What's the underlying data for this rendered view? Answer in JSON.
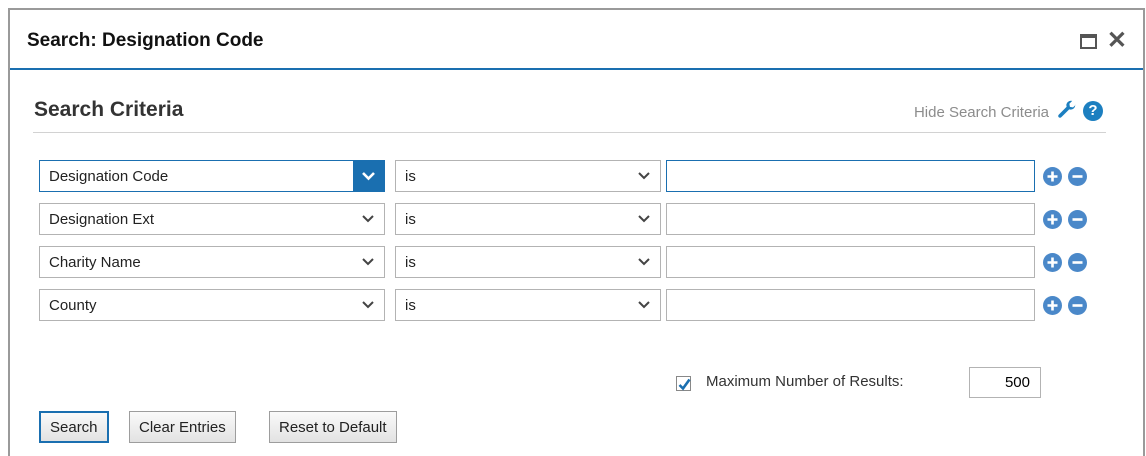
{
  "window": {
    "title": "Search: Designation Code",
    "maximize_icon": "maximize-icon",
    "close_icon": "close-icon",
    "close_glyph": "✕"
  },
  "section": {
    "title": "Search Criteria",
    "hide_link": "Hide Search Criteria",
    "wrench_icon": "wrench-icon",
    "help_icon": "help-icon",
    "help_glyph": "?"
  },
  "criteria": [
    {
      "field": "Designation Code",
      "operator": "is",
      "value": ""
    },
    {
      "field": "Designation Ext",
      "operator": "is",
      "value": ""
    },
    {
      "field": "Charity Name",
      "operator": "is",
      "value": ""
    },
    {
      "field": "County",
      "operator": "is",
      "value": ""
    }
  ],
  "max_results": {
    "checked": true,
    "label": "Maximum Number of Results:",
    "value": "500"
  },
  "buttons": {
    "search": "Search",
    "clear": "Clear Entries",
    "reset": "Reset to Default"
  },
  "colors": {
    "accent": "#1a6fb0",
    "round_button": "#4a88c9"
  }
}
